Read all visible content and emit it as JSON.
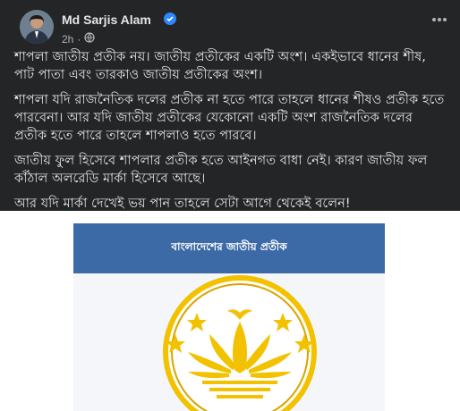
{
  "post": {
    "author": "Md Sarjis Alam",
    "time": "2h",
    "separator": "·",
    "paragraphs": [
      "শাপলা জাতীয় প্রতীক নয়। জাতীয় প্রতীকের একটি অংশ। একইভাবে ধানের শীষ, পাট পাতা এবং তারকাও জাতীয় প্রতীকের অংশ।",
      "শাপলা যদি রাজনৈতিক দলের প্রতীক না হতে পারে তাহলে ধানের শীষও প্রতীক হতে পারবেনা। আর যদি জাতীয় প্রতীকের যেকোনো একটি অংশ রাজনৈতিক দলের প্রতীক হতে পারে তাহলে শাপলাও হতে পারবে।",
      "জাতীয় ফুল হিসেবে শাপলার প্রতীক হতে আইনগত বাধা নেই। কারণ জাতীয় ফল কাঁঠাল অলরেডি মার্কা হিসেবে আছে।",
      "আর যদি মার্কা দেখেই ভয় পান তাহলে সেটা আগে থেকেই বলেন!"
    ]
  },
  "media": {
    "caption": "বাংলাদেশের জাতীয় প্রতীক",
    "colors": {
      "header": "#3c6aa6",
      "gold": "#f2c200",
      "gold_dark": "#d9a400"
    }
  },
  "icons": {
    "verified": "verified-badge-icon",
    "audience": "globe-icon",
    "menu": "more-options-icon"
  }
}
